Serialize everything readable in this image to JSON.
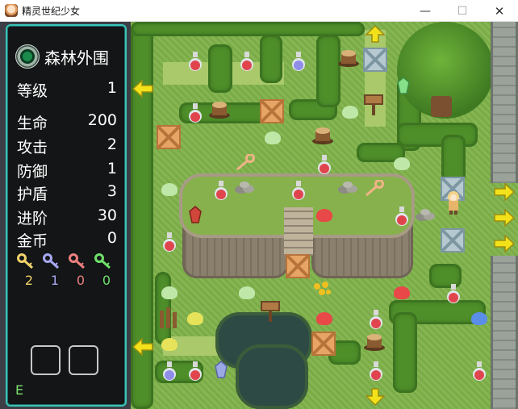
{
  "window": {
    "title": "精灵世纪少女",
    "min_glyph": "—",
    "max_glyph": "☐",
    "close_glyph": "✕"
  },
  "status": {
    "floor_name": "森林外围",
    "stats": [
      {
        "label": "等级",
        "value": "1"
      },
      {
        "label": "生命",
        "value": "200"
      },
      {
        "label": "攻击",
        "value": "2"
      },
      {
        "label": "防御",
        "value": "1"
      },
      {
        "label": "护盾",
        "value": "3"
      },
      {
        "label": "进阶",
        "value": "30"
      },
      {
        "label": "金币",
        "value": "0"
      }
    ],
    "keys": [
      {
        "name": "yellow-key",
        "count": "2",
        "color": "#f1d36a"
      },
      {
        "name": "blue-key",
        "count": "1",
        "color": "#a8a8f2"
      },
      {
        "name": "red-key",
        "count": "0",
        "color": "#ec7f7f"
      },
      {
        "name": "green-key",
        "count": "0",
        "color": "#6fe06a"
      }
    ],
    "equip_label": "E"
  },
  "colors": {
    "panel_border": "#39c4b8",
    "grass": "#7fb24a",
    "hedge": "#4f8f2a"
  },
  "map_entities": {
    "potions_red": 13,
    "potions_blue": 2,
    "arrows": [
      "up",
      "down",
      "left",
      "left",
      "right",
      "right",
      "right"
    ]
  }
}
